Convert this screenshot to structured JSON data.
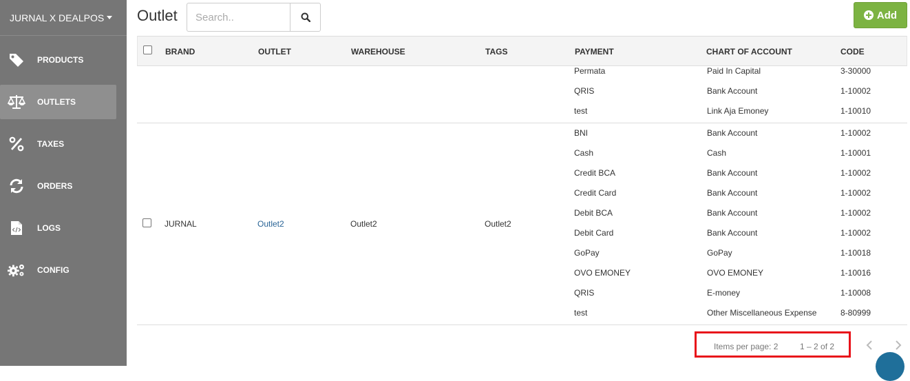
{
  "app": {
    "brand": "JURNAL X DEALPOS"
  },
  "sidebar": {
    "items": [
      {
        "label": "PRODUCTS",
        "icon": "tag-icon",
        "active": false
      },
      {
        "label": "OUTLETS",
        "icon": "balance-scale-icon",
        "active": true
      },
      {
        "label": "TAXES",
        "icon": "percent-icon",
        "active": false
      },
      {
        "label": "ORDERS",
        "icon": "refresh-icon",
        "active": false
      },
      {
        "label": "LOGS",
        "icon": "code-file-icon",
        "active": false
      },
      {
        "label": "CONFIG",
        "icon": "gears-icon",
        "active": false
      }
    ]
  },
  "header": {
    "title": "Outlet",
    "search_placeholder": "Search..",
    "add_label": "Add"
  },
  "table": {
    "columns": [
      "BRAND",
      "OUTLET",
      "WAREHOUSE",
      "TAGS",
      "PAYMENT",
      "CHART OF ACCOUNT",
      "CODE"
    ],
    "row1_partial": {
      "payments": [
        {
          "payment": "Permata",
          "account": "Paid In Capital",
          "code": "3-30000"
        },
        {
          "payment": "QRIS",
          "account": "Bank Account",
          "code": "1-10002"
        },
        {
          "payment": "test",
          "account": "Link Aja Emoney",
          "code": "1-10010"
        }
      ]
    },
    "row2": {
      "brand": "JURNAL",
      "outlet": "Outlet2",
      "warehouse": "Outlet2",
      "tags": "Outlet2",
      "payments": [
        {
          "payment": "BNI",
          "account": "Bank Account",
          "code": "1-10002"
        },
        {
          "payment": "Cash",
          "account": "Cash",
          "code": "1-10001"
        },
        {
          "payment": "Credit BCA",
          "account": "Bank Account",
          "code": "1-10002"
        },
        {
          "payment": "Credit Card",
          "account": "Bank Account",
          "code": "1-10002"
        },
        {
          "payment": "Debit BCA",
          "account": "Bank Account",
          "code": "1-10002"
        },
        {
          "payment": "Debit Card",
          "account": "Bank Account",
          "code": "1-10002"
        },
        {
          "payment": "GoPay",
          "account": "GoPay",
          "code": "1-10018"
        },
        {
          "payment": "OVO EMONEY",
          "account": "OVO EMONEY",
          "code": "1-10016"
        },
        {
          "payment": "QRIS",
          "account": "E-money",
          "code": "1-10008"
        },
        {
          "payment": "test",
          "account": "Other Miscellaneous Expense",
          "code": "8-80999"
        }
      ]
    }
  },
  "pagination": {
    "items_per_page": "Items per page: 2",
    "range": "1 – 2 of 2"
  },
  "colors": {
    "sidebar": "#767676",
    "accent_green": "#7cb342",
    "highlight_red": "#e8121a",
    "link": "#2a6496"
  }
}
